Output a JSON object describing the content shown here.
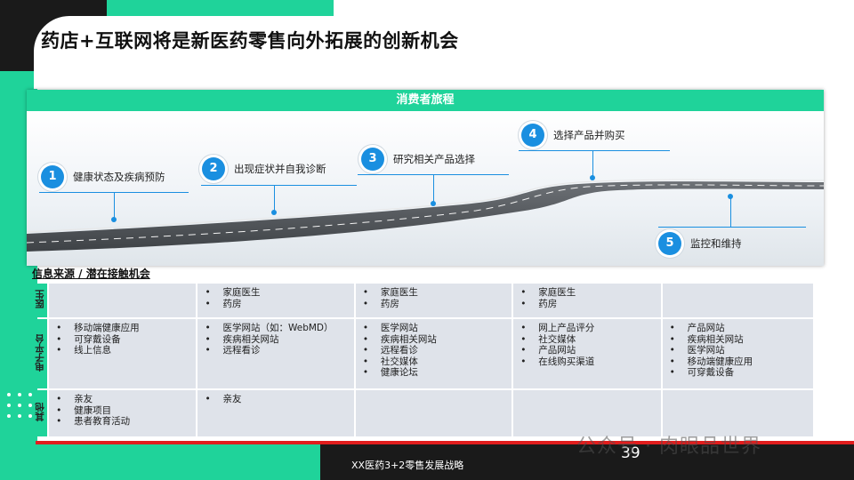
{
  "page": {
    "title": "药店+互联网将是新医药零售向外拓展的创新机会",
    "footer_text": "XX医药3+2零售发展战略",
    "page_number": "39",
    "watermark": "公众号 · 肉眼品世界"
  },
  "journey": {
    "header": "消费者旅程",
    "steps": [
      {
        "num": "1",
        "label": "健康状态及疾病预防"
      },
      {
        "num": "2",
        "label": "出现症状并自我诊断"
      },
      {
        "num": "3",
        "label": "研究相关产品选择"
      },
      {
        "num": "4",
        "label": "选择产品并购买"
      },
      {
        "num": "5",
        "label": "监控和维持"
      }
    ]
  },
  "info": {
    "title": "信息来源 / 潜在接触机会",
    "rows": [
      {
        "head": "医生",
        "cells": [
          [],
          [
            "家庭医生",
            "药房"
          ],
          [
            "家庭医生",
            "药房"
          ],
          [
            "家庭医生",
            "药房"
          ],
          []
        ]
      },
      {
        "head": "电子平台",
        "cells": [
          [
            "移动端健康应用",
            "可穿戴设备",
            "线上信息"
          ],
          [
            "医学网站（如：WebMD）",
            "疾病相关网站",
            "远程看诊"
          ],
          [
            "医学网站",
            "疾病相关网站",
            "远程看诊",
            "社交媒体",
            "健康论坛"
          ],
          [
            "网上产品评分",
            "社交媒体",
            "产品网站",
            "在线购买渠道"
          ],
          [
            "产品网站",
            "疾病相关网站",
            "医学网站",
            "移动端健康应用",
            "可穿戴设备"
          ]
        ]
      },
      {
        "head": "其他",
        "cells": [
          [
            "亲友",
            "健康项目",
            "患者教育活动"
          ],
          [
            "亲友"
          ],
          [],
          [],
          []
        ]
      }
    ]
  },
  "colors": {
    "accent_green": "#1fd39a",
    "step_blue": "#1a8fe0",
    "footer_red": "#e11d1d",
    "cell_gray": "#dfe3ea"
  }
}
